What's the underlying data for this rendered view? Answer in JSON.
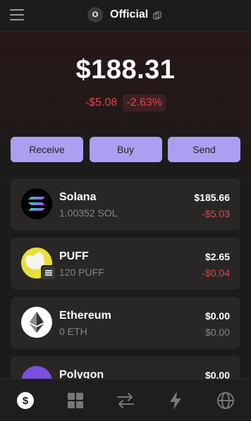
{
  "account": {
    "avatar_letter": "O",
    "name": "Official"
  },
  "balance": {
    "total": "$188.31",
    "change_usd": "-$5.08",
    "change_pct": "-2.63%"
  },
  "actions": {
    "receive": "Receive",
    "buy": "Buy",
    "send": "Send"
  },
  "tokens": [
    {
      "name": "Solana",
      "balance": "1.00352 SOL",
      "value": "$185.66",
      "change": "-$5.03",
      "icon": "solana-logo"
    },
    {
      "name": "PUFF",
      "balance": "120 PUFF",
      "value": "$2.65",
      "change": "-$0.04",
      "icon": "puff-logo"
    },
    {
      "name": "Ethereum",
      "balance": "0 ETH",
      "value": "$0.00",
      "change": "$0.00",
      "icon": "ethereum-logo"
    },
    {
      "name": "Polygon",
      "value": "$0.00",
      "icon": "polygon-logo"
    }
  ],
  "nav": [
    "wallet",
    "collectibles",
    "swap",
    "activity",
    "explore"
  ],
  "colors": {
    "accent": "#ab9ff2",
    "negative": "#e0454c",
    "card": "#292626"
  }
}
